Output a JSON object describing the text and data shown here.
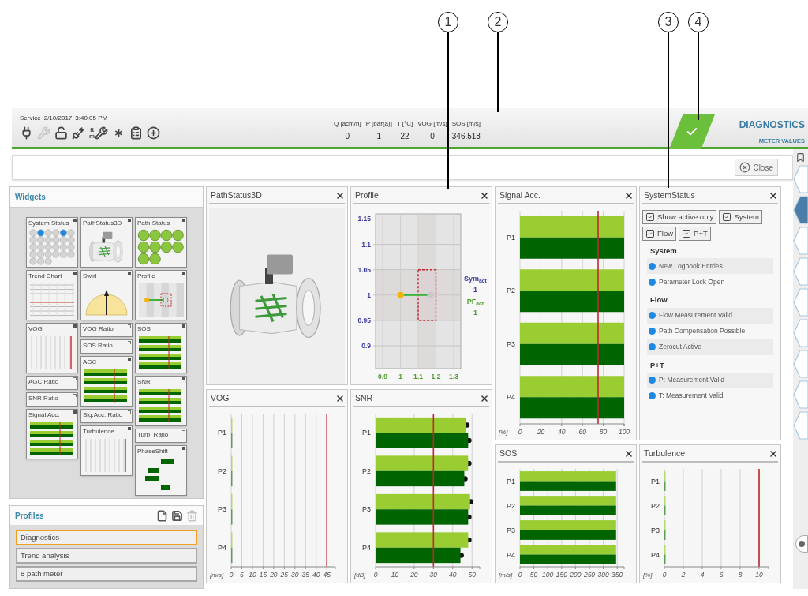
{
  "callouts": [
    {
      "label": "1"
    },
    {
      "label": "2"
    },
    {
      "label": "3"
    },
    {
      "label": "4"
    }
  ],
  "status": {
    "mode": "Service",
    "date": "2/10/2017",
    "time": "3:40:05 PM"
  },
  "tools": [
    {
      "disabled": false
    },
    {
      "disabled": true
    },
    {
      "disabled": false
    },
    {
      "disabled": false
    },
    {
      "disabled": false,
      "unit_top": "ft",
      "unit_bottom": "m"
    },
    {
      "disabled": false
    },
    {
      "disabled": false
    },
    {
      "disabled": false
    }
  ],
  "readings": [
    {
      "label": "Q [acm/h]",
      "value": "0"
    },
    {
      "label": "P [bar(a)]",
      "value": "1"
    },
    {
      "label": "T [°C]",
      "value": "22"
    },
    {
      "label": "VOG [m/s]",
      "value": "0"
    },
    {
      "label": "SOS [m/s]",
      "value": "346.518"
    }
  ],
  "title": "DIAGNOSTICS",
  "subtitle": "METER VALUES",
  "close_button": "Close",
  "widgets": {
    "title": "Widgets",
    "columns": [
      [
        {
          "label": "System Status",
          "kind": "dots"
        },
        {
          "label": "Trend Chart",
          "kind": "trend"
        },
        {
          "label": "VOG",
          "kind": "vlines"
        },
        {
          "label": "AGC Ratio",
          "kind": "ratio"
        },
        {
          "label": "SNR Ratio",
          "kind": "ratio"
        },
        {
          "label": "Signal Acc.",
          "kind": "bars"
        }
      ],
      [
        {
          "label": "PathStatus3D",
          "kind": "meter"
        },
        {
          "label": "Swirl",
          "kind": "gauge"
        },
        {
          "label": "VOG Ratio",
          "kind": "ratio"
        },
        {
          "label": "SOS Ratio",
          "kind": "ratio"
        },
        {
          "label": "AGC",
          "kind": "bars"
        },
        {
          "label": "Sig.Acc. Ratio",
          "kind": "ratio"
        },
        {
          "label": "Turbulence",
          "kind": "vlines"
        }
      ],
      [
        {
          "label": "Path Status",
          "kind": "circles"
        },
        {
          "label": "Profile",
          "kind": "profile"
        },
        {
          "label": "SOS",
          "kind": "bars"
        },
        {
          "label": "SNR",
          "kind": "bars"
        },
        {
          "label": "Turb. Ratio",
          "kind": "ratio"
        },
        {
          "label": "PhaseShift",
          "kind": "phase"
        }
      ]
    ]
  },
  "profiles": {
    "title": "Profiles",
    "actions": [
      {
        "disabled": false
      },
      {
        "disabled": false
      },
      {
        "disabled": true
      }
    ],
    "items": [
      {
        "label": "Diagnostics",
        "selected": true
      },
      {
        "label": "Trend analysis",
        "selected": false
      },
      {
        "label": "8 path meter",
        "selected": false
      }
    ]
  },
  "columns": [
    [
      {
        "kind": "model",
        "title": "PathStatus3D"
      },
      {
        "kind": "bars",
        "title": "VOG",
        "chart_data": {
          "type": "bar",
          "orientation": "horizontal",
          "xlabel": "[m/s]",
          "categories": [
            "P1",
            "P2",
            "P3",
            "P4"
          ],
          "series": [
            {
              "color": "#b5d96a",
              "values": [
                0,
                0,
                0,
                0
              ]
            },
            {
              "color": "#5a9e5a",
              "values": [
                0,
                0,
                0,
                0
              ]
            }
          ],
          "xlim": [
            0,
            49
          ],
          "xticks": [
            0,
            5,
            10,
            15,
            20,
            25,
            30,
            35,
            40,
            45
          ],
          "grid": true,
          "ref_lines": [
            {
              "axis": "x",
              "value": 45
            }
          ]
        }
      }
    ],
    [
      {
        "kind": "profile",
        "title": "Profile",
        "sym_label": "Sym$_{act}$",
        "sym_value": "1",
        "pf_label": "PF$_{act}$",
        "pf_value": "1",
        "chart_data": {
          "type": "scatter",
          "x": [
            1,
            1.17
          ],
          "series": [
            {
              "color": "#f5b400",
              "values": [
                1,
                null
              ]
            },
            {
              "color": "#c8c8c8",
              "values": [
                null,
                1
              ]
            }
          ],
          "xlim": [
            0.86,
            1.34
          ],
          "ylim": [
            0.855,
            1.16
          ],
          "xticks": [
            0.9,
            1,
            1.1,
            1.2,
            1.3
          ],
          "yticks": [
            0.9,
            0.95,
            1,
            1.05,
            1.1,
            1.15
          ],
          "grid": true,
          "bands": [
            {
              "axis": "x",
              "from": 1.1,
              "to": 1.2
            },
            {
              "axis": "y",
              "from": 0.95,
              "to": 1.05
            }
          ]
        }
      },
      {
        "kind": "bars",
        "title": "SNR",
        "markers": true,
        "chart_data": {
          "type": "bar",
          "orientation": "horizontal",
          "xlabel": "[dB]",
          "categories": [
            "P1",
            "P2",
            "P3",
            "P4"
          ],
          "series": [
            {
              "color": "#9acd32",
              "values": [
                47,
                48,
                49,
                48
              ]
            },
            {
              "color": "#006400",
              "values": [
                48,
                46,
                48,
                44
              ]
            }
          ],
          "xlim": [
            0,
            54
          ],
          "xticks": [
            0,
            10,
            20,
            30,
            40,
            50
          ],
          "grid": true,
          "ref_lines": [
            {
              "axis": "x",
              "value": 30
            }
          ]
        }
      }
    ],
    [
      {
        "kind": "bars",
        "title": "Signal Acc.",
        "chart_data": {
          "type": "bar",
          "orientation": "horizontal",
          "xlabel": "[%]",
          "categories": [
            "P1",
            "P2",
            "P3",
            "P4"
          ],
          "series": [
            {
              "color": "#9acd32",
              "values": [
                100,
                100,
                100,
                100
              ]
            },
            {
              "color": "#006400",
              "values": [
                100,
                100,
                100,
                100
              ]
            }
          ],
          "xlim": [
            0,
            100
          ],
          "xticks": [
            0,
            20,
            40,
            60,
            80,
            100
          ],
          "grid": true,
          "ref_lines": [
            {
              "axis": "x",
              "value": 75
            }
          ]
        }
      },
      {
        "kind": "bars",
        "title": "SOS",
        "chart_data": {
          "type": "bar",
          "orientation": "horizontal",
          "xlabel": "[m/s]",
          "categories": [
            "P1",
            "P2",
            "P3",
            "P4"
          ],
          "series": [
            {
              "color": "#9acd32",
              "values": [
                346,
                346,
                346,
                346
              ]
            },
            {
              "color": "#006400",
              "values": [
                346,
                346,
                346,
                346
              ]
            }
          ],
          "xlim": [
            0,
            375
          ],
          "xticks": [
            0,
            50,
            100,
            150,
            200,
            250,
            300,
            350
          ],
          "grid": true
        }
      }
    ],
    [
      {
        "kind": "status",
        "title": "SystemStatus",
        "filters": [
          {
            "label": "Show active only",
            "checked": true
          },
          {
            "label": "System",
            "checked": true
          },
          {
            "label": "Flow",
            "checked": true
          },
          {
            "label": "P+T",
            "checked": true
          }
        ],
        "groups": [
          {
            "title": "System",
            "items": [
              {
                "label": "New Logbook Entries",
                "color": "#1e88e5"
              },
              {
                "label": "Parameter Lock Open",
                "color": "#1e88e5"
              }
            ]
          },
          {
            "title": "Flow",
            "items": [
              {
                "label": "Flow Measurement Valid",
                "color": "#1e88e5"
              },
              {
                "label": "Path Compensation Possible",
                "color": "#1e88e5"
              },
              {
                "label": "Zerocut Active",
                "color": "#1e88e5"
              }
            ]
          },
          {
            "title": "P+T",
            "items": [
              {
                "label": "P: Measurement Valid",
                "color": "#1e88e5"
              },
              {
                "label": "T: Measurement Valid",
                "color": "#1e88e5"
              }
            ]
          }
        ]
      },
      {
        "kind": "bars",
        "title": "Turbulence",
        "chart_data": {
          "type": "bar",
          "orientation": "horizontal",
          "xlabel": "[%]",
          "categories": [
            "P1",
            "P2",
            "P3",
            "P4"
          ],
          "series": [
            {
              "color": "#b5d96a",
              "values": [
                0,
                0,
                0,
                0
              ]
            },
            {
              "color": "#5a9e5a",
              "values": [
                0,
                0,
                0,
                0
              ]
            }
          ],
          "xlim": [
            0,
            11
          ],
          "xticks": [
            0,
            2,
            4,
            6,
            8,
            10
          ],
          "grid": true,
          "ref_lines": [
            {
              "axis": "x",
              "value": 10
            }
          ]
        }
      }
    ]
  ],
  "nav": [
    {
      "selected": false
    },
    {
      "selected": true
    },
    {
      "selected": false
    },
    {
      "selected": false
    },
    {
      "selected": false
    },
    {
      "selected": false
    },
    {
      "selected": false
    },
    {
      "selected": false
    },
    {
      "selected": false
    }
  ]
}
